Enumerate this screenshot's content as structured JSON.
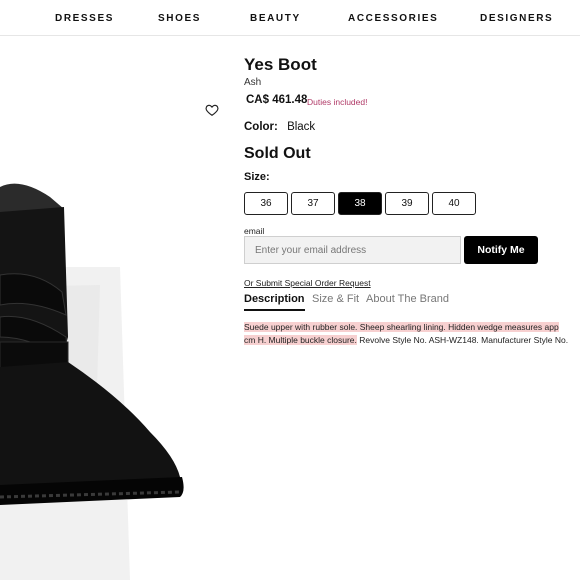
{
  "nav": {
    "items": [
      "DRESSES",
      "SHOES",
      "BEAUTY",
      "ACCESSORIES",
      "DESIGNERS"
    ]
  },
  "product": {
    "title": "Yes Boot",
    "brand": "Ash",
    "price": "CA$ 461.48",
    "duties_note": "Duties included!",
    "color_label": "Color:",
    "color_value": "Black",
    "status": "Sold Out",
    "size_label": "Size:",
    "sizes": [
      "36",
      "37",
      "38",
      "39",
      "40"
    ],
    "selected_size": "38"
  },
  "notify": {
    "email_label": "email",
    "email_placeholder": "Enter your email address",
    "button_label": "Notify Me",
    "special_order_link": "Or Submit Special Order Request"
  },
  "tabs": {
    "items": [
      "Description",
      "Size & Fit",
      "About The Brand"
    ],
    "active": "Description"
  },
  "description": {
    "line1_highlight": "Suede upper with rubber sole. Sheep shearling lining. Hidden wedge measures app",
    "line2_highlight": "cm H. Multiple buckle closure.",
    "line2_rest": " Revolve Style No. ASH-WZ148. Manufacturer Style No."
  },
  "icons": {
    "wishlist": "heart-outline-icon"
  },
  "colors": {
    "accent_duties": "#b03a67",
    "highlight": "#f7d0d0",
    "selected_size_bg": "#000000"
  }
}
